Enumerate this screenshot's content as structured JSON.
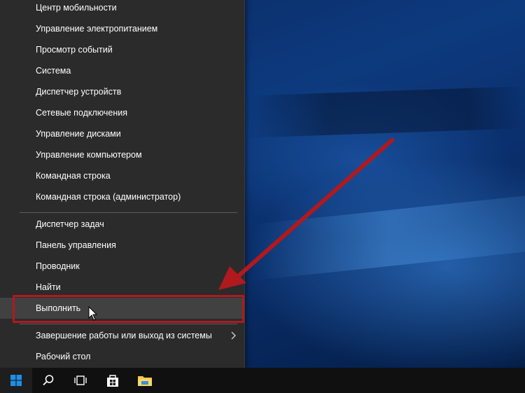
{
  "menu": {
    "group1": [
      {
        "label": "Центр мобильности"
      },
      {
        "label": "Управление электропитанием"
      },
      {
        "label": "Просмотр событий"
      },
      {
        "label": "Система"
      },
      {
        "label": "Диспетчер устройств"
      },
      {
        "label": "Сетевые подключения"
      },
      {
        "label": "Управление дисками"
      },
      {
        "label": "Управление компьютером"
      },
      {
        "label": "Командная строка"
      },
      {
        "label": "Командная строка (администратор)"
      }
    ],
    "group2": [
      {
        "label": "Диспетчер задач"
      },
      {
        "label": "Панель управления"
      },
      {
        "label": "Проводник"
      },
      {
        "label": "Найти"
      },
      {
        "label": "Выполнить"
      }
    ],
    "group3": [
      {
        "label": "Завершение работы или выход из системы"
      },
      {
        "label": "Рабочий стол"
      }
    ]
  },
  "taskbar": {
    "icons": [
      "windows-start-icon",
      "search-icon",
      "task-view-icon",
      "store-icon",
      "file-explorer-icon"
    ]
  },
  "colors": {
    "menu_bg": "#2b2b2b",
    "menu_text": "#ffffff",
    "hover_bg": "#414141",
    "annotation_red": "#b0191e",
    "taskbar_bg": "#101010",
    "start_blue": "#1e8fe8"
  }
}
